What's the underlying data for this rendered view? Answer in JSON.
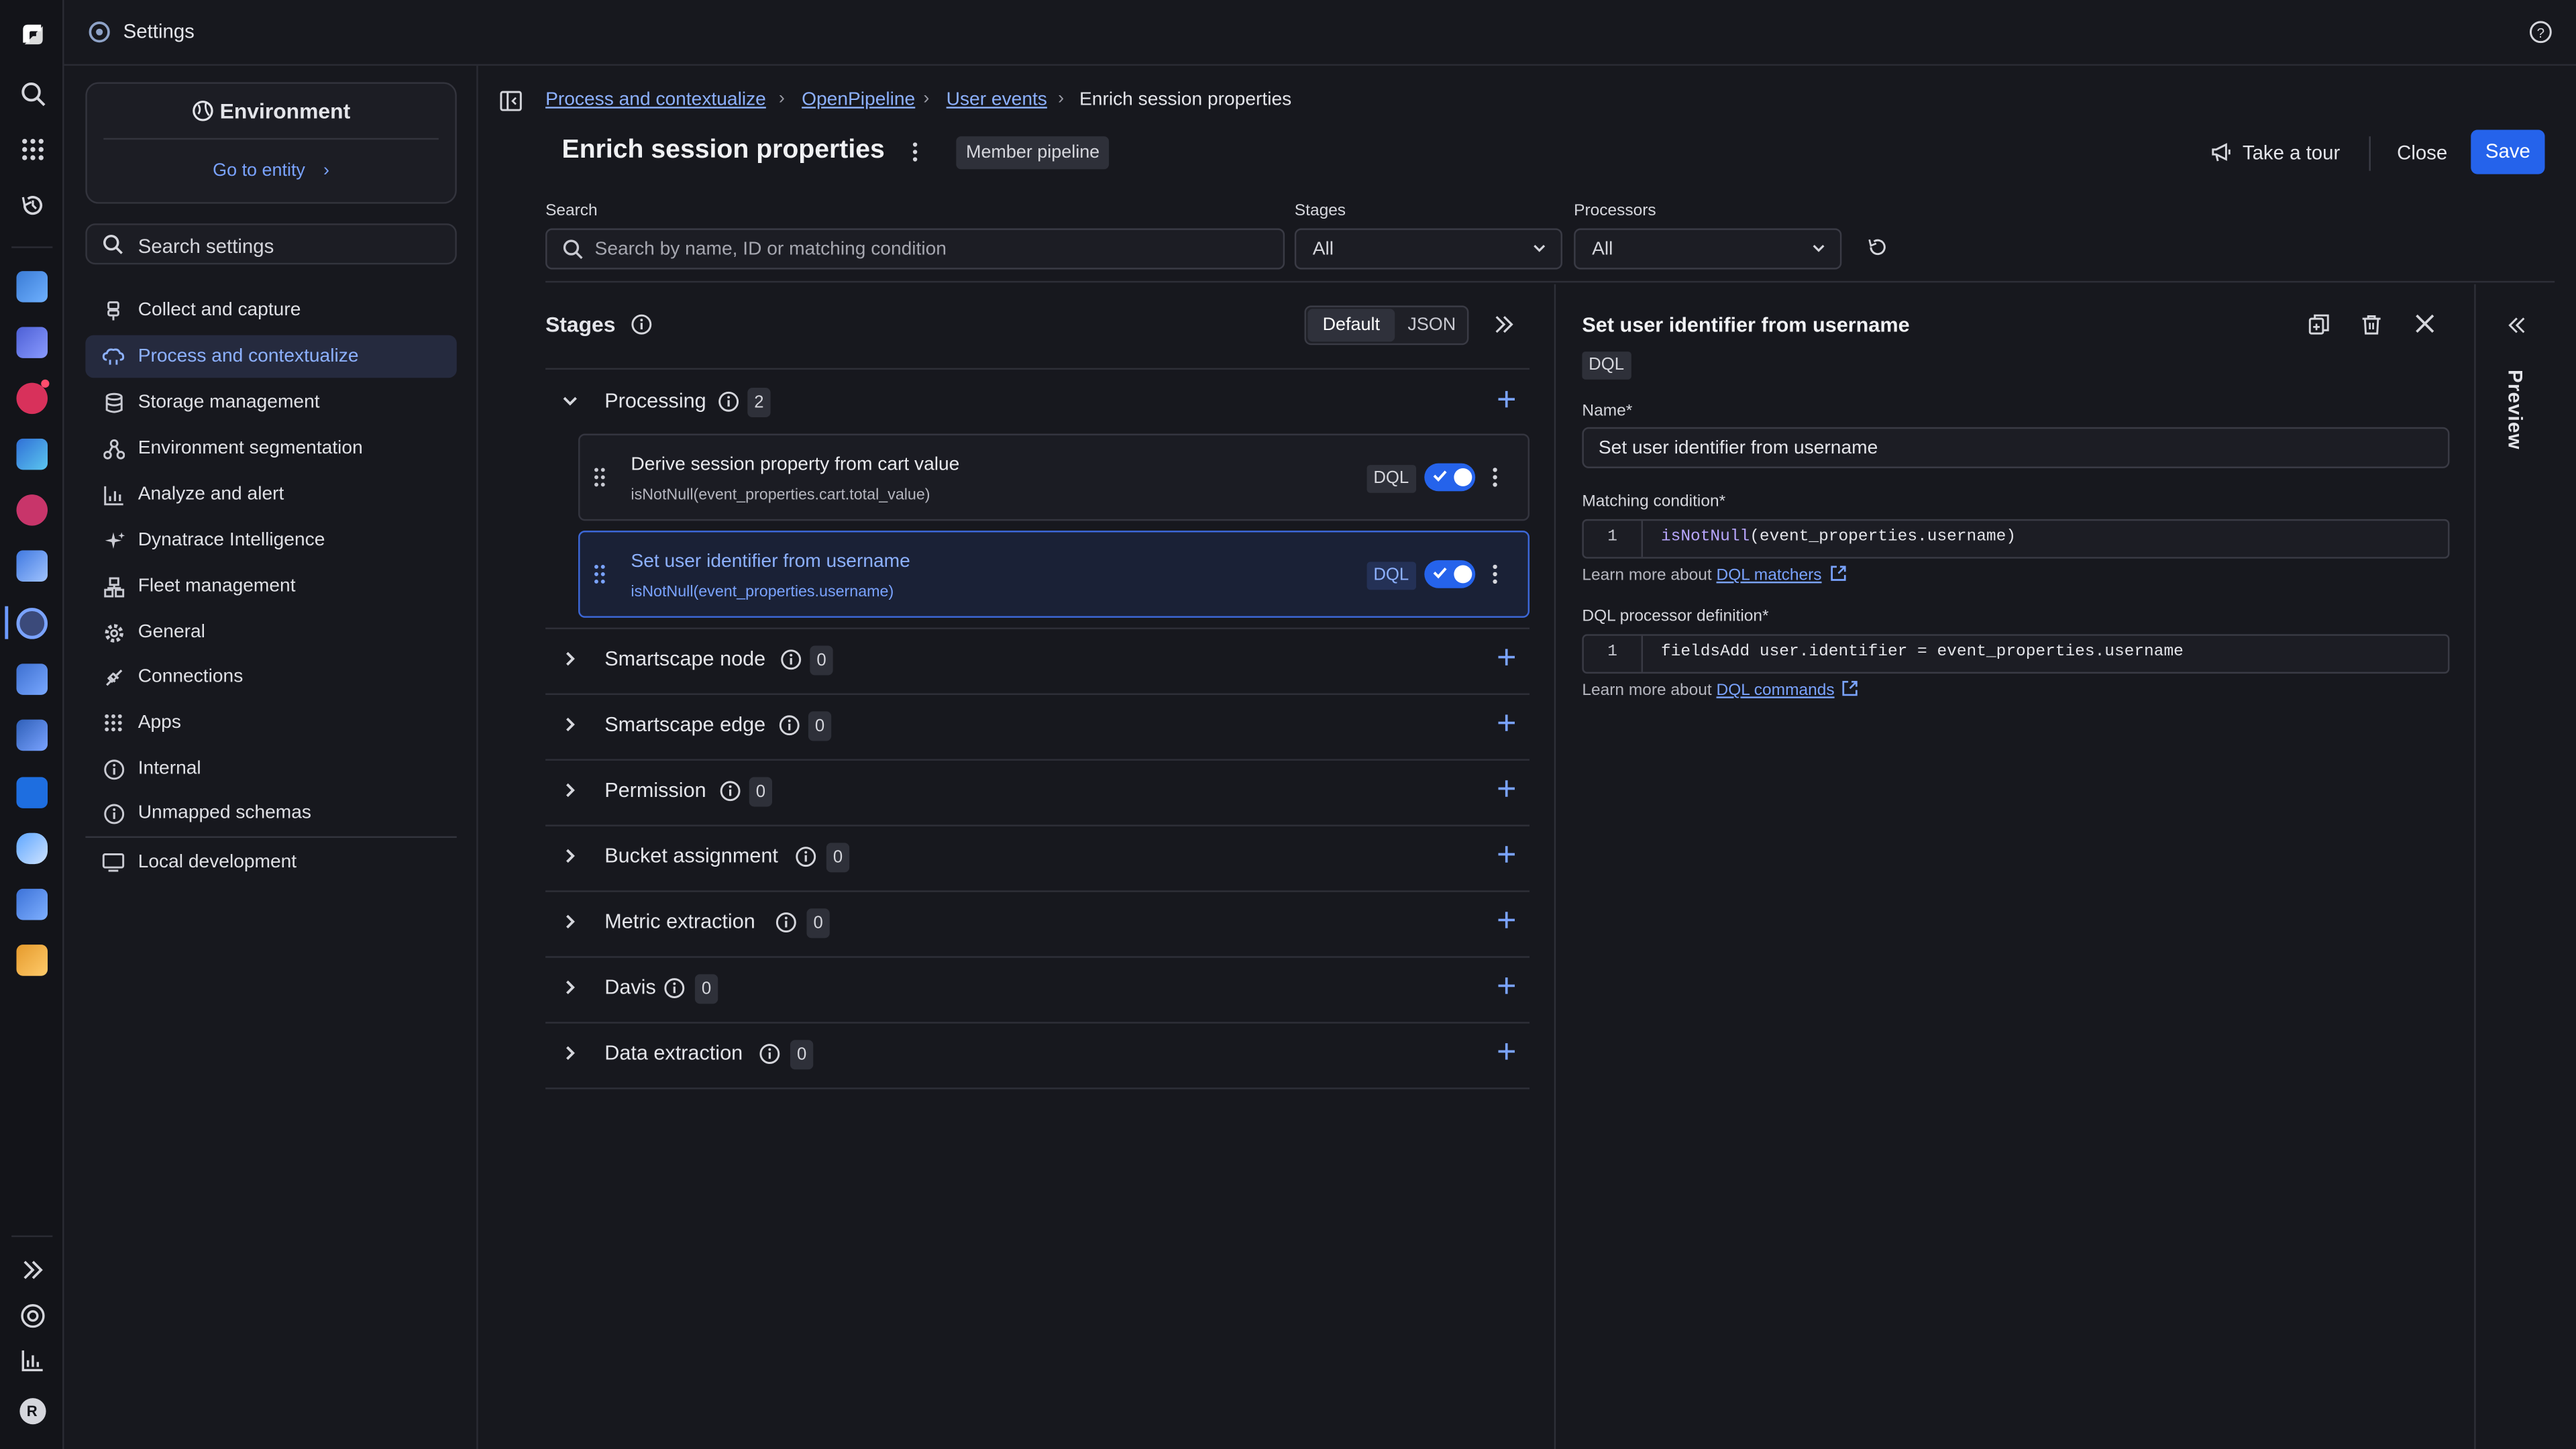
{
  "topbar": {
    "title": "Settings"
  },
  "nav": {
    "environment_title": "Environment",
    "goto_entity": "Go to entity",
    "search_label": "Search settings",
    "items": [
      {
        "label": "Collect and capture",
        "icon": "collect-icon"
      },
      {
        "label": "Process and contextualize",
        "icon": "process-icon",
        "active": true
      },
      {
        "label": "Storage management",
        "icon": "database-icon"
      },
      {
        "label": "Environment segmentation",
        "icon": "segmentation-icon"
      },
      {
        "label": "Analyze and alert",
        "icon": "analyze-icon"
      },
      {
        "label": "Dynatrace Intelligence",
        "icon": "sparkle-icon"
      },
      {
        "label": "Fleet management",
        "icon": "fleet-icon"
      },
      {
        "label": "General",
        "icon": "gear-icon"
      },
      {
        "label": "Connections",
        "icon": "connections-icon"
      },
      {
        "label": "Apps",
        "icon": "apps-icon"
      },
      {
        "label": "Internal",
        "icon": "info-icon"
      },
      {
        "label": "Unmapped schemas",
        "icon": "info-icon"
      },
      {
        "label": "Local development",
        "icon": "monitor-icon"
      }
    ]
  },
  "breadcrumb": {
    "items": [
      "Process and contextualize",
      "OpenPipeline",
      "User events"
    ],
    "current": "Enrich session properties"
  },
  "header": {
    "title": "Enrich session properties",
    "badge": "Member pipeline",
    "tour": "Take a tour",
    "close": "Close",
    "save": "Save"
  },
  "filters": {
    "search_label": "Search",
    "search_placeholder": "Search by name, ID or matching condition",
    "stages_label": "Stages",
    "stages_value": "All",
    "processors_label": "Processors",
    "processors_value": "All"
  },
  "stages": {
    "title": "Stages",
    "view_default": "Default",
    "view_json": "JSON",
    "list": [
      {
        "name": "Processing",
        "count": "2",
        "expanded": true
      },
      {
        "name": "Smartscape node",
        "count": "0"
      },
      {
        "name": "Smartscape edge",
        "count": "0"
      },
      {
        "name": "Permission",
        "count": "0"
      },
      {
        "name": "Bucket assignment",
        "count": "0"
      },
      {
        "name": "Metric extraction",
        "count": "0"
      },
      {
        "name": "Davis",
        "count": "0"
      },
      {
        "name": "Data extraction",
        "count": "0"
      }
    ],
    "processors": [
      {
        "name": "Derive session property from cart value",
        "condition": "isNotNull(event_properties.cart.total_value)",
        "tag": "DQL",
        "enabled": true
      },
      {
        "name": "Set user identifier from username",
        "condition": "isNotNull(event_properties.username)",
        "tag": "DQL",
        "enabled": true,
        "selected": true
      }
    ]
  },
  "detail": {
    "title": "Set user identifier from username",
    "tag": "DQL",
    "name_label": "Name*",
    "name_value": "Set user identifier from username",
    "matching_label": "Matching condition*",
    "matching_line": "1",
    "matching_fn": "isNotNull",
    "matching_rest": "(event_properties.username)",
    "learn_prefix": "Learn more about",
    "matchers_link": "DQL matchers",
    "def_label": "DQL processor definition*",
    "def_line": "1",
    "def_code": "fieldsAdd user.identifier = event_properties.username",
    "commands_link": "DQL commands",
    "preview": "Preview"
  },
  "rail": {
    "avatar_initial": "R"
  }
}
